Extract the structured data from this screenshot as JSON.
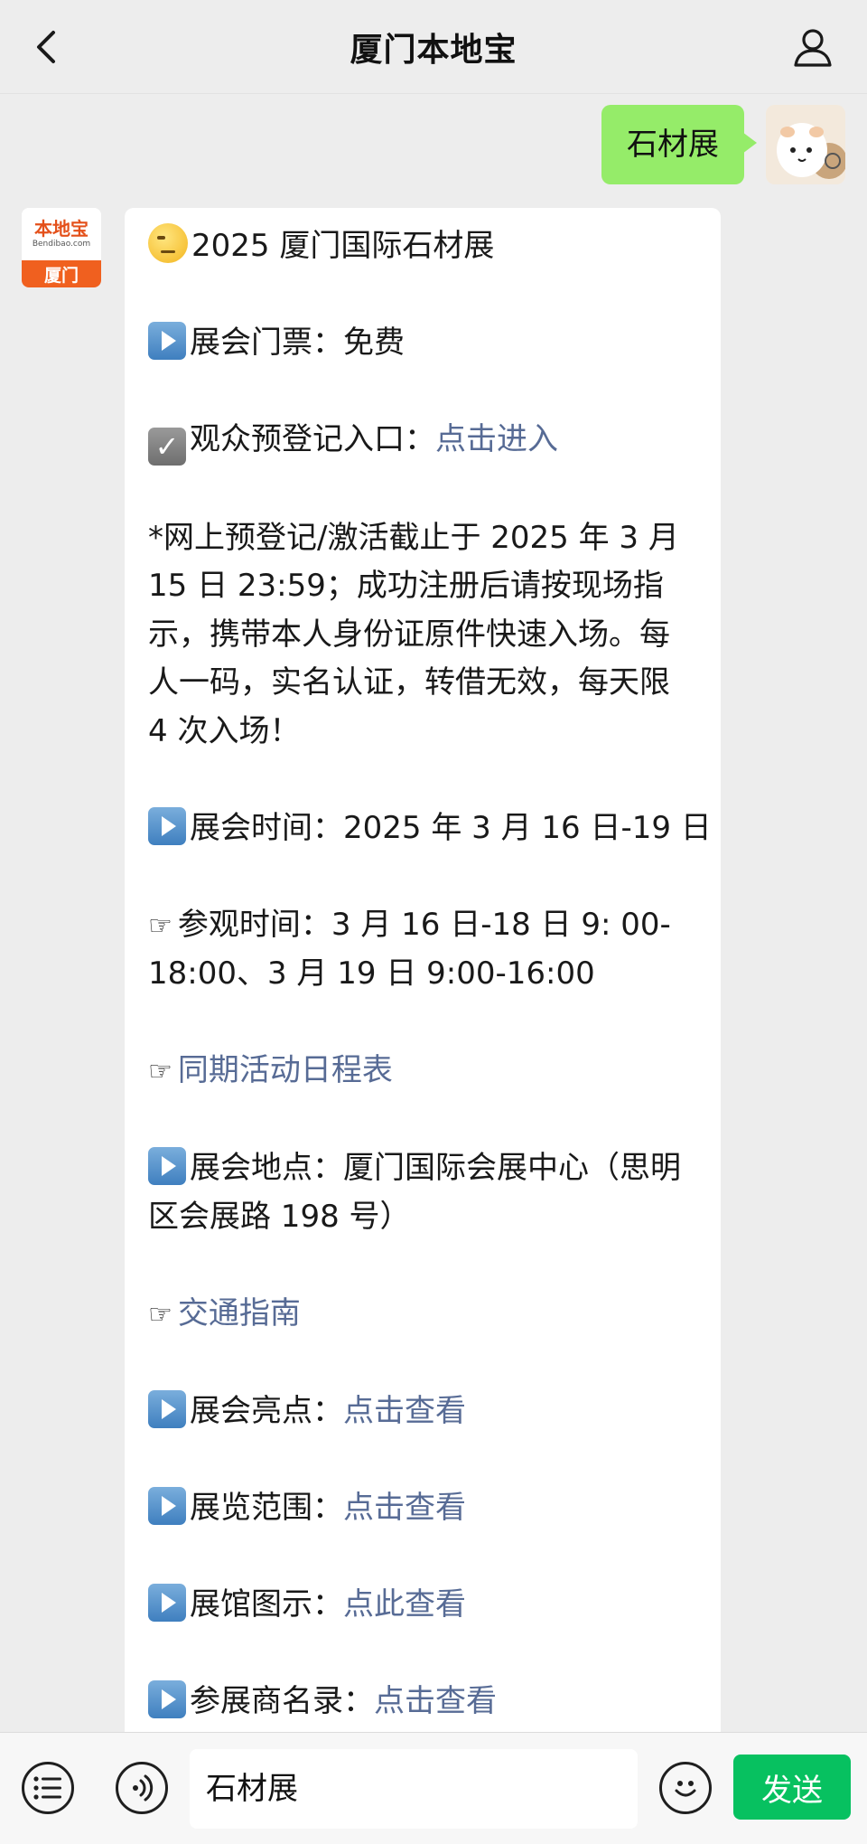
{
  "header": {
    "title": "厦门本地宝"
  },
  "outgoing": {
    "text": "石材展"
  },
  "bot": {
    "avatar_top": "本地宝",
    "avatar_domain": "Bendibao.com",
    "avatar_city": "厦门"
  },
  "message": {
    "title": "2025 厦门国际石材展",
    "ticket_label": "展会门票：",
    "ticket_value": "免费",
    "reg_label": "观众预登记入口：",
    "reg_link": "点击进入",
    "notice": "*网上预登记/激活截止于 2025 年 3 月 15 日 23:59；成功注册后请按现场指示，携带本人身份证原件快速入场。每人一码，实名认证，转借无效，每天限 4 次入场！",
    "time_label": "展会时间：2025 年 3 月 16 日-19 日",
    "visit_time": "参观时间：3 月 16 日-18 日 9: 00-18:00、3 月 19 日 9:00-16:00",
    "schedule_link": "同期活动日程表",
    "venue": "展会地点：厦门国际会展中心（思明区会展路 198 号）",
    "traffic_link": "交通指南",
    "highlights_label": "展会亮点：",
    "highlights_link": "点击查看",
    "scope_label": "展览范围：",
    "scope_link": "点击查看",
    "map_label": "展馆图示：",
    "map_link": "点此查看",
    "exhibitors_label": "参展商名录：",
    "exhibitors_link": "点击查看"
  },
  "input": {
    "value": "石材展",
    "send_label": "发送"
  },
  "icons": {
    "back": "chevron-left-icon",
    "profile": "person-icon",
    "menu": "list-icon",
    "voice": "voice-icon",
    "emoji": "smiley-icon"
  },
  "colors": {
    "bubble_out": "#95ec69",
    "link": "#576b95",
    "send": "#07c160"
  }
}
